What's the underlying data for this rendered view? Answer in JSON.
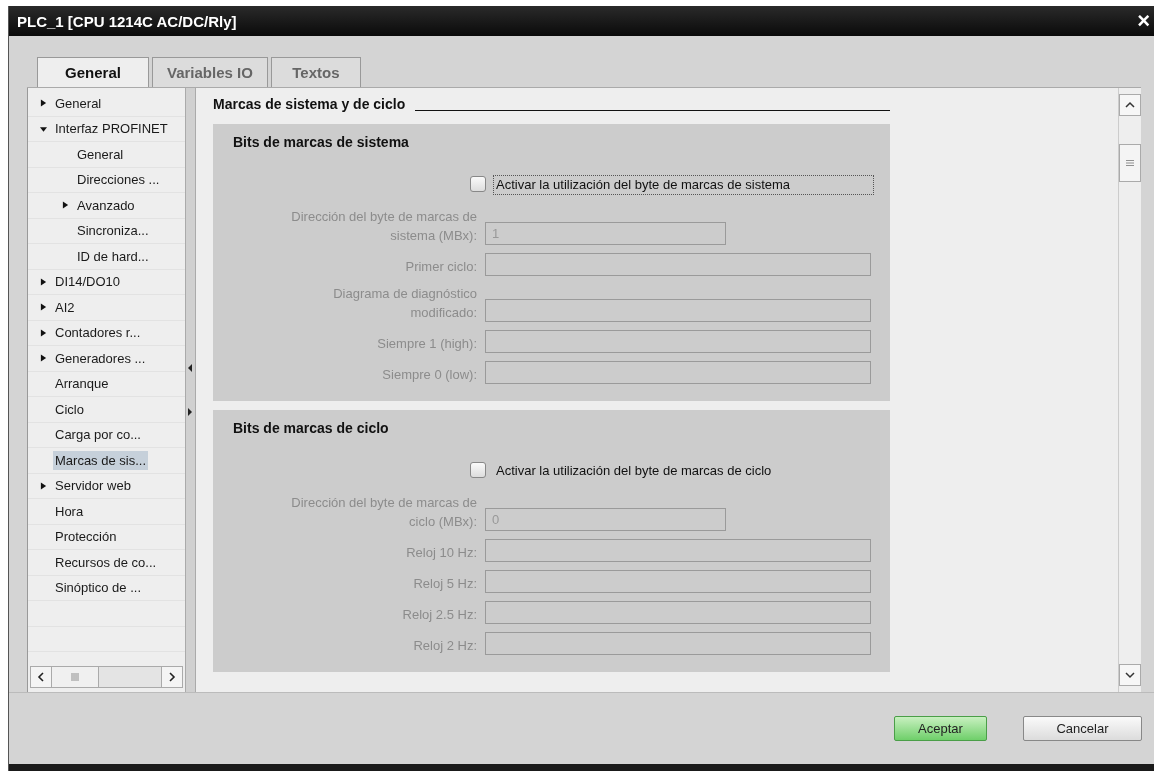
{
  "window": {
    "title": "PLC_1 [CPU 1214C AC/DC/Rly]",
    "close": "×"
  },
  "tabs": [
    {
      "label": "General",
      "selected": true
    },
    {
      "label": "Variables IO",
      "selected": false
    },
    {
      "label": "Textos",
      "selected": false
    }
  ],
  "sidebar": {
    "items": [
      {
        "label": "General",
        "expanded": false,
        "selected": false
      },
      {
        "label": "Interfaz PROFINET",
        "expanded": true,
        "selected": false,
        "children": [
          {
            "label": "General",
            "selected": false
          },
          {
            "label": "Direcciones ...",
            "selected": false
          },
          {
            "label": "Avanzado",
            "expanded": false,
            "selected": false
          },
          {
            "label": "Sincroniza...",
            "selected": false
          },
          {
            "label": "ID de hard...",
            "selected": false
          }
        ]
      },
      {
        "label": "DI14/DO10",
        "expanded": false,
        "selected": false
      },
      {
        "label": "AI2",
        "expanded": false,
        "selected": false
      },
      {
        "label": "Contadores r...",
        "expanded": false,
        "selected": false
      },
      {
        "label": "Generadores ...",
        "expanded": false,
        "selected": false
      },
      {
        "label": "Arranque",
        "selected": false
      },
      {
        "label": "Ciclo",
        "selected": false
      },
      {
        "label": "Carga por co...",
        "selected": false
      },
      {
        "label": "Marcas de sis...",
        "selected": true
      },
      {
        "label": "Servidor web",
        "expanded": false,
        "selected": false
      },
      {
        "label": "Hora",
        "selected": false
      },
      {
        "label": "Protección",
        "selected": false
      },
      {
        "label": "Recursos de co...",
        "selected": false
      },
      {
        "label": "Sinóptico de ...",
        "selected": false
      }
    ]
  },
  "section": {
    "title": "Marcas de sistema y de ciclo",
    "panels": [
      {
        "title": "Bits de marcas de sistema",
        "checkbox": {
          "label": "Activar la utilización del byte de marcas de sistema",
          "checked": false,
          "focused": true
        },
        "fields": [
          {
            "label": "Dirección del byte de marcas de sistema (MBx):",
            "value": "1",
            "kind": "short",
            "disabled": true
          },
          {
            "label": "Primer ciclo:",
            "kind": "long",
            "disabled": true
          },
          {
            "label": "Diagrama de diagnóstico modificado:",
            "kind": "long",
            "disabled": true
          },
          {
            "label": "Siempre 1 (high):",
            "kind": "long",
            "disabled": true
          },
          {
            "label": "Siempre 0 (low):",
            "kind": "long",
            "disabled": true
          }
        ]
      },
      {
        "title": "Bits de marcas de ciclo",
        "checkbox": {
          "label": "Activar la utilización del byte de marcas de ciclo",
          "checked": false,
          "focused": false
        },
        "fields": [
          {
            "label": "Dirección del byte de marcas de ciclo (MBx):",
            "value": "0",
            "kind": "short",
            "disabled": true
          },
          {
            "label": "Reloj 10 Hz:",
            "kind": "long",
            "disabled": true
          },
          {
            "label": "Reloj 5 Hz:",
            "kind": "long",
            "disabled": true
          },
          {
            "label": "Reloj 2.5 Hz:",
            "kind": "long",
            "disabled": true
          },
          {
            "label": "Reloj 2 Hz:",
            "kind": "long",
            "disabled": true
          }
        ]
      }
    ]
  },
  "buttons": [
    {
      "label": "Aceptar",
      "default": true
    },
    {
      "label": "Cancelar",
      "default": false
    }
  ]
}
